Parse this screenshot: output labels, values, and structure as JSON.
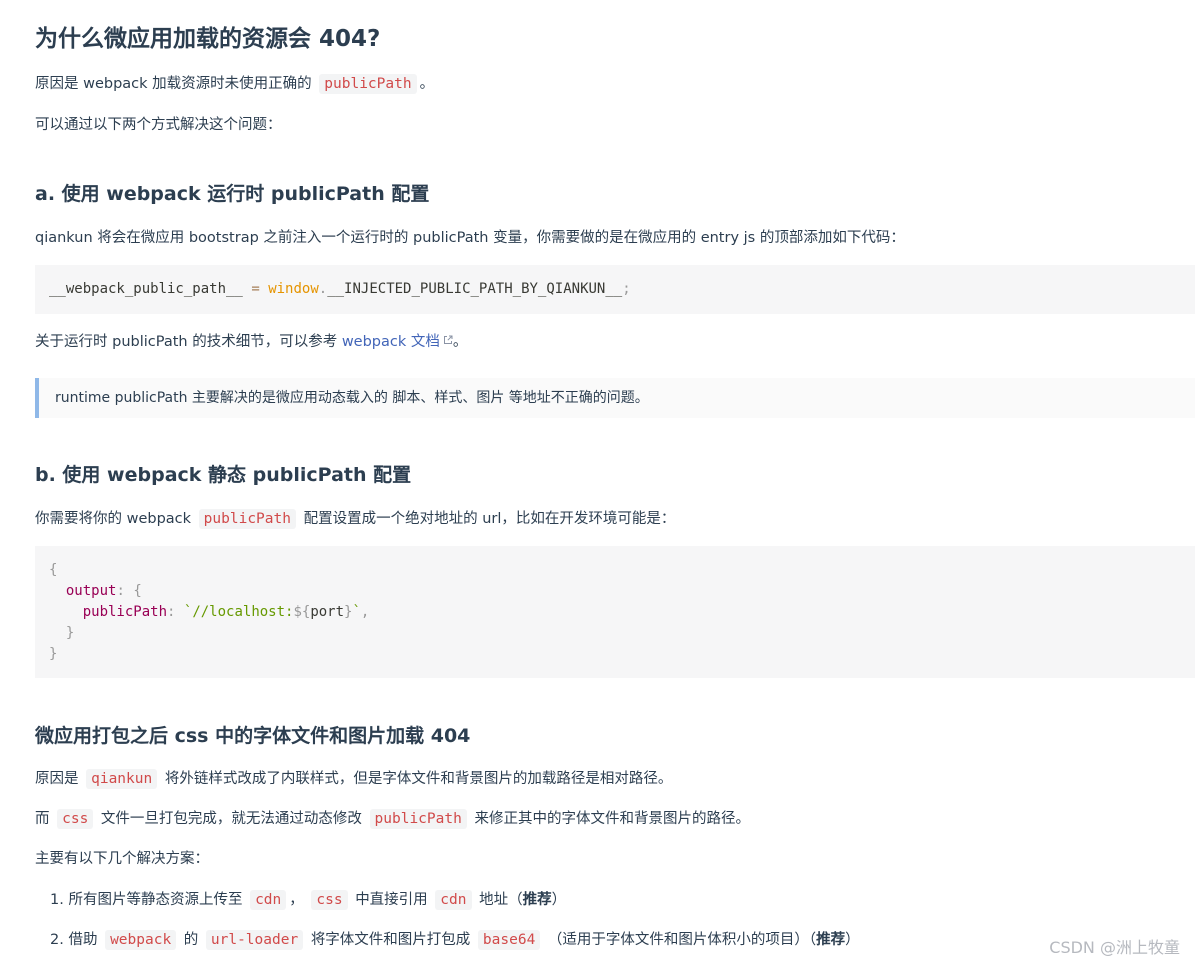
{
  "heading_404": "为什么微应用加载的资源会 404?",
  "reason": {
    "prefix": "原因是 webpack 加载资源时未使用正确的",
    "code": "publicPath",
    "suffix": "。"
  },
  "solve_intro": "可以通过以下两个方式解决这个问题：",
  "section_a": {
    "heading": "a. 使用 webpack 运行时 publicPath 配置",
    "desc": "qiankun 将会在微应用 bootstrap 之前注入一个运行时的 publicPath 变量，你需要做的是在微应用的 entry js 的顶部添加如下代码：",
    "code": {
      "var": "__webpack_public_path__",
      "op": "=",
      "obj": "window",
      "dot": ".",
      "prop": "__INJECTED_PUBLIC_PATH_BY_QIANKUN__",
      "semi": ";"
    },
    "ref_prefix": "关于运行时 publicPath 的技术细节，可以参考",
    "ref_link": "webpack 文档",
    "ref_suffix": "。",
    "quote": "runtime publicPath 主要解决的是微应用动态载入的 脚本、样式、图片 等地址不正确的问题。"
  },
  "section_b": {
    "heading": "b. 使用 webpack 静态 publicPath 配置",
    "desc_prefix": "你需要将你的 webpack",
    "desc_code": "publicPath",
    "desc_suffix": "配置设置成一个绝对地址的 url，比如在开发环境可能是：",
    "code": {
      "open": "{",
      "output_key": "output",
      "colon": ":",
      "output_open": "{",
      "pp_key": "publicPath",
      "str_start": "`//localhost:",
      "interp_open": "${",
      "interp_var": "port",
      "interp_close": "}",
      "str_end": "`",
      "comma": ",",
      "inner_close": "}",
      "close": "}"
    }
  },
  "section_css": {
    "heading": "微应用打包之后 css 中的字体文件和图片加载 404",
    "p1_prefix": "原因是",
    "p1_code": "qiankun",
    "p1_suffix": "将外链样式改成了内联样式，但是字体文件和背景图片的加载路径是相对路径。",
    "p2_prefix": "而",
    "p2_code1": "css",
    "p2_mid": "文件一旦打包完成，就无法通过动态修改",
    "p2_code2": "publicPath",
    "p2_suffix": "来修正其中的字体文件和背景图片的路径。",
    "p3": "主要有以下几个解决方案：",
    "list": [
      {
        "num": "1.",
        "t1": "所有图片等静态资源上传至",
        "c1": "cdn",
        "t2": "，",
        "c2": "css",
        "t3": "中直接引用",
        "c3": "cdn",
        "t4": "地址（",
        "bold": "推荐",
        "t5": "）"
      },
      {
        "num": "2.",
        "t1": "借助",
        "c1": "webpack",
        "t2": "的",
        "c2": "url-loader",
        "t3": "将字体文件和图片打包成",
        "c3": "base64",
        "t4": "（适用于字体文件和图片体积小的项目）（",
        "bold": "推荐",
        "t5": "）"
      }
    ]
  },
  "watermark": "CSDN @洲上牧童",
  "colors": {
    "inline_code": "#d14a4a",
    "link": "#4265b8",
    "quote_border": "#8fb8e8",
    "code_bg": "#f6f6f7"
  }
}
